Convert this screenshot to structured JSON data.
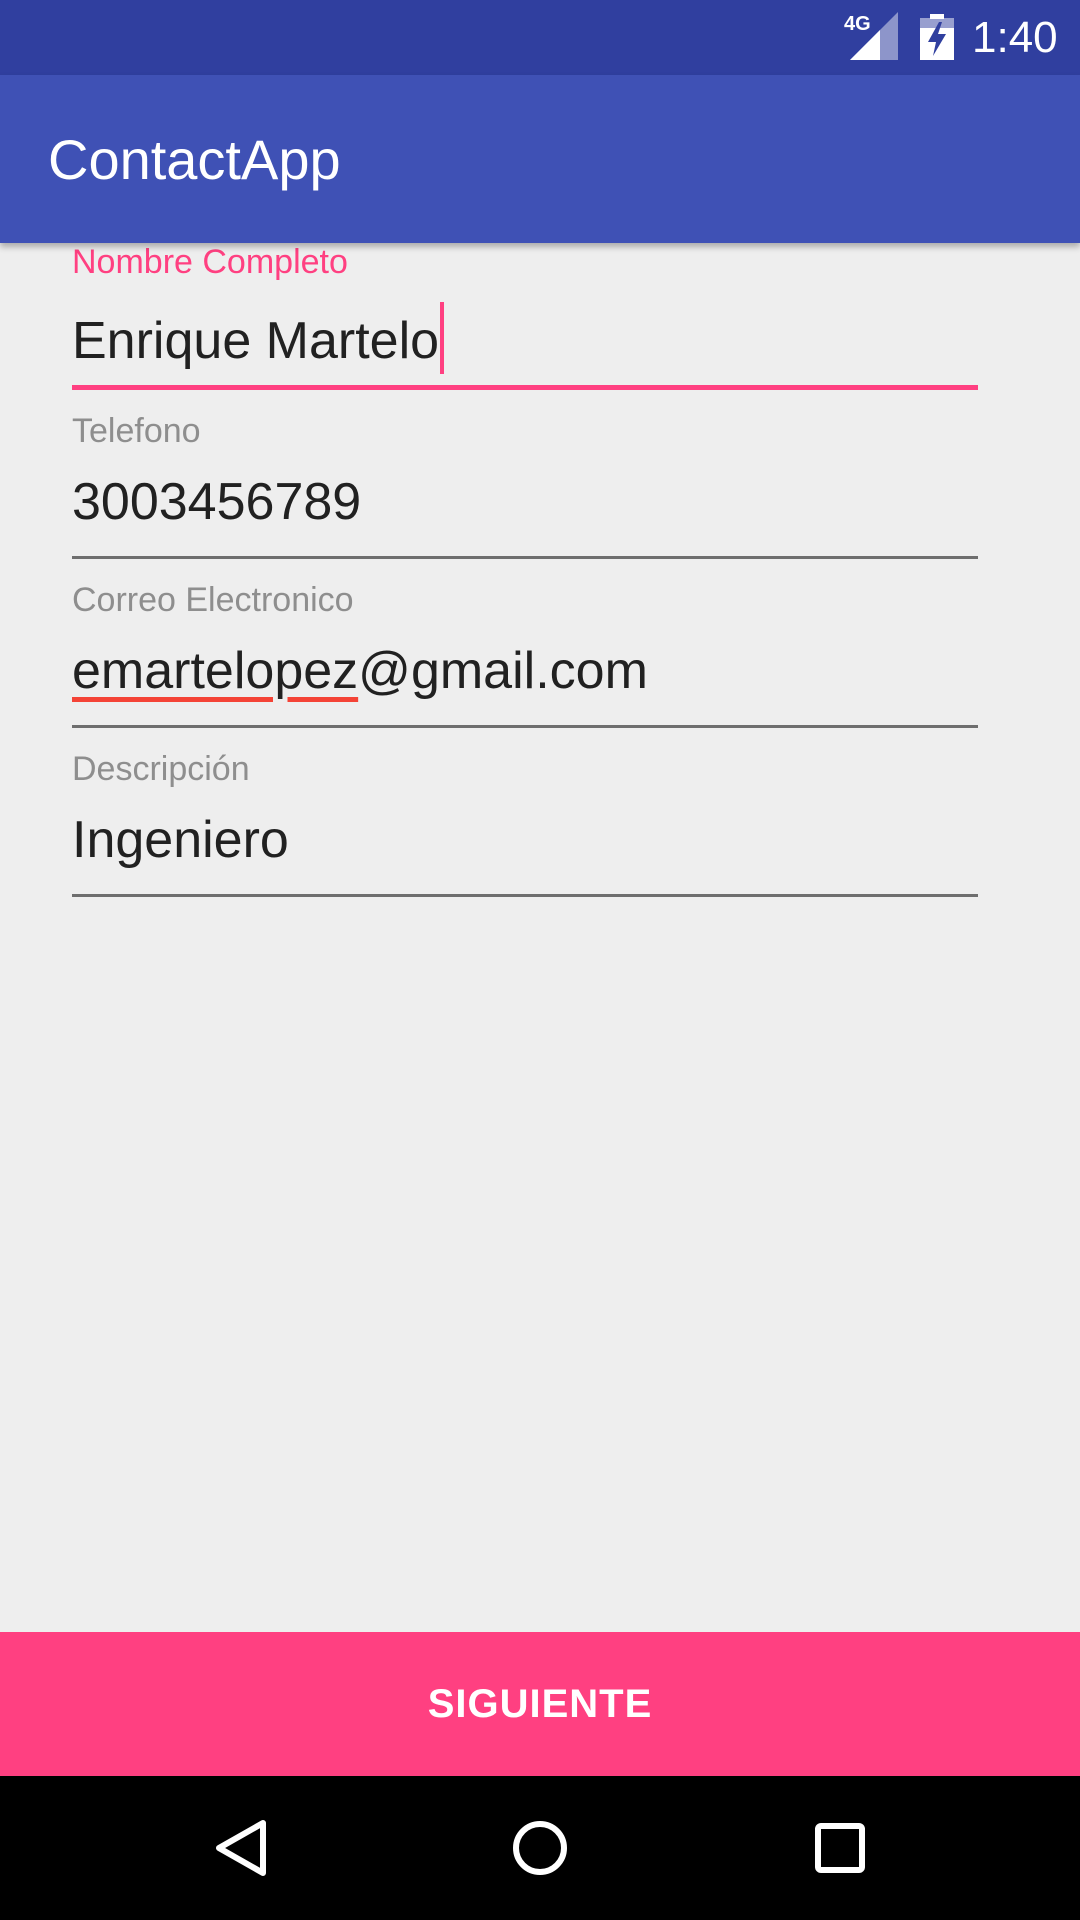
{
  "status_bar": {
    "network_label": "4G",
    "time": "1:40",
    "background_color": "#303f9f"
  },
  "app_bar": {
    "title": "ContactApp",
    "background_color": "#3f51b5"
  },
  "form": {
    "fields": [
      {
        "label": "Nombre Completo",
        "value": "Enrique Martelo",
        "focused": true
      },
      {
        "label": "Telefono",
        "value": "3003456789",
        "focused": false
      },
      {
        "label": "Correo Electronico",
        "value_misspelled_part": "emartelopez",
        "value_rest": "@gmail.com",
        "focused": false
      },
      {
        "label": "Descripción",
        "value": "Ingeniero",
        "focused": false
      }
    ]
  },
  "next_button": {
    "label": "SIGUIENTE",
    "background_color": "#ff4081"
  },
  "navigation": {
    "back_icon": "back-triangle-icon",
    "home_icon": "home-circle-icon",
    "recents_icon": "recents-square-icon"
  },
  "accent_color": "#ff4081"
}
